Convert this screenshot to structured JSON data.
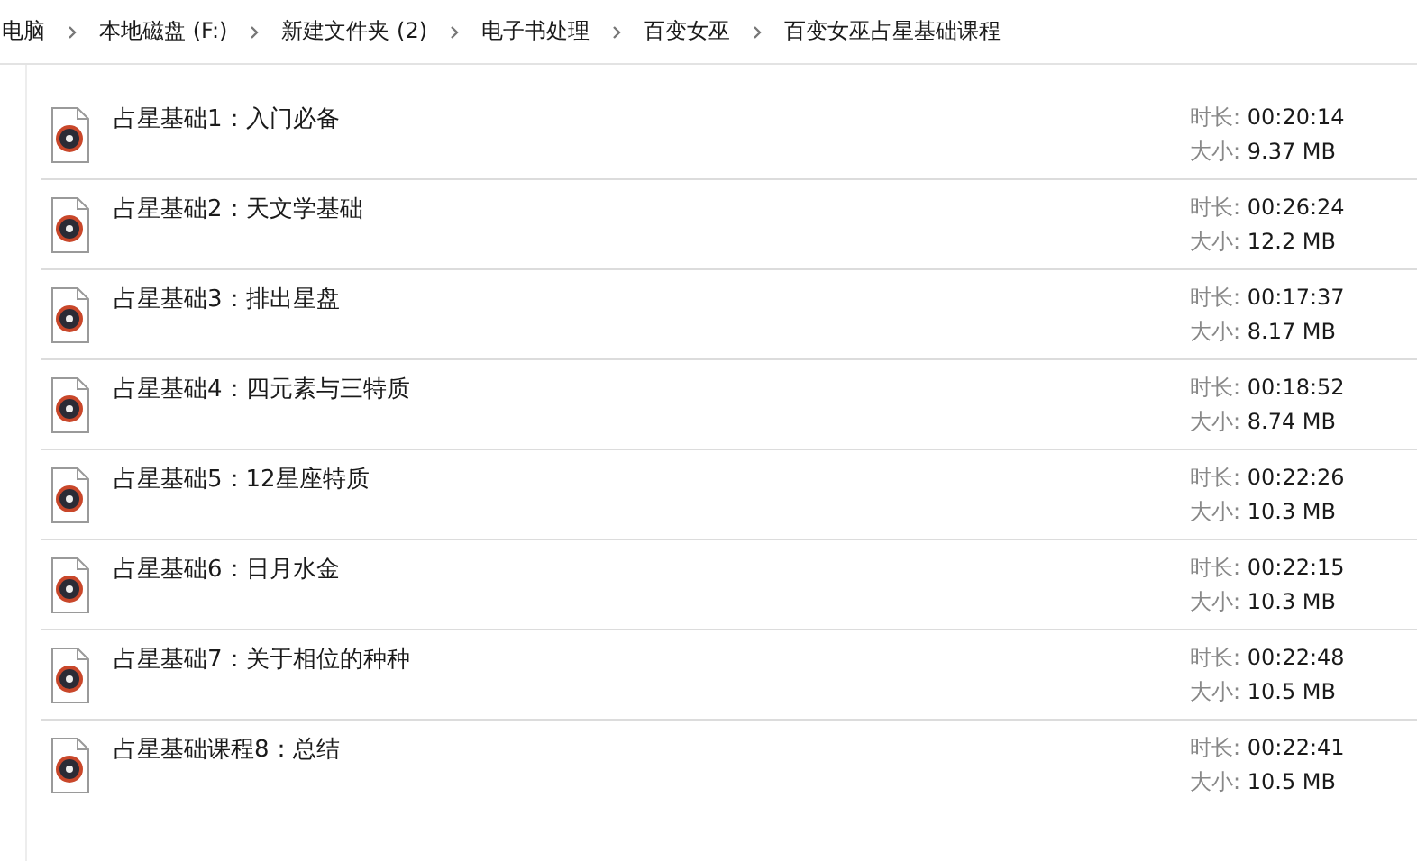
{
  "breadcrumb": [
    "电脑",
    "本地磁盘 (F:)",
    "新建文件夹 (2)",
    "电子书处理",
    "百变女巫",
    "百变女巫占星基础课程"
  ],
  "files": [
    {
      "name": "占星基础1：入门必备",
      "duration_label": "时长:",
      "duration": "00:20:14",
      "size_label": "大小:",
      "size": "9.37 MB"
    },
    {
      "name": "占星基础2：天文学基础",
      "duration_label": "时长:",
      "duration": "00:26:24",
      "size_label": "大小:",
      "size": "12.2 MB"
    },
    {
      "name": "占星基础3：排出星盘",
      "duration_label": "时长:",
      "duration": "00:17:37",
      "size_label": "大小:",
      "size": "8.17 MB"
    },
    {
      "name": "占星基础4：四元素与三特质",
      "duration_label": "时长:",
      "duration": "00:18:52",
      "size_label": "大小:",
      "size": "8.74 MB"
    },
    {
      "name": "占星基础5：12星座特质",
      "duration_label": "时长:",
      "duration": "00:22:26",
      "size_label": "大小:",
      "size": "10.3 MB"
    },
    {
      "name": "占星基础6：日月水金",
      "duration_label": "时长:",
      "duration": "00:22:15",
      "size_label": "大小:",
      "size": "10.3 MB"
    },
    {
      "name": "占星基础7：关于相位的种种",
      "duration_label": "时长:",
      "duration": "00:22:48",
      "size_label": "大小:",
      "size": "10.5 MB"
    },
    {
      "name": "占星基础课程8：总结",
      "duration_label": "时长:",
      "duration": "00:22:41",
      "size_label": "大小:",
      "size": "10.5 MB"
    }
  ]
}
